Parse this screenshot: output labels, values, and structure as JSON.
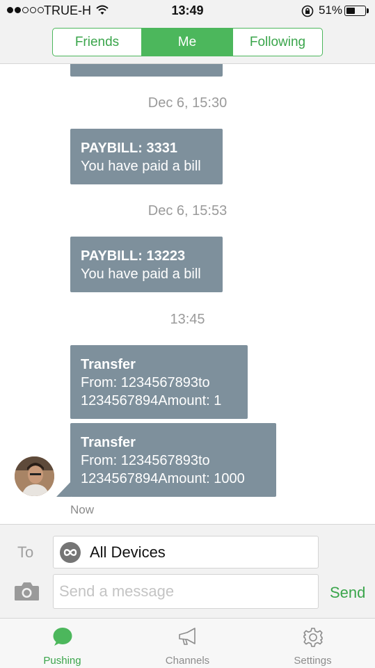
{
  "status_bar": {
    "carrier": "TRUE-H",
    "signal_bars_filled": 2,
    "signal_bars_total": 5,
    "time": "13:49",
    "battery_percent_label": "51%",
    "battery_level": 0.51
  },
  "header": {
    "tabs": [
      {
        "label": "Friends",
        "active": false
      },
      {
        "label": "Me",
        "active": true
      },
      {
        "label": "Following",
        "active": false
      }
    ]
  },
  "chat": {
    "timestamps": [
      "Dec 6, 15:30",
      "Dec 6, 15:53",
      "13:45"
    ],
    "messages": [
      {
        "title": "PAYBILL: 3331",
        "body": "You have paid a bill"
      },
      {
        "title": "PAYBILL: 13223",
        "body": "You have paid a bill"
      },
      {
        "title": "Transfer",
        "body": " From: 1234567893to\n1234567894Amount: 1"
      },
      {
        "title": "Transfer",
        "body": " From: 1234567893to\n1234567894Amount: 1000"
      }
    ],
    "last_status": "Now"
  },
  "compose": {
    "to_label": "To",
    "recipient": "All Devices",
    "message_placeholder": "Send a message",
    "message_value": "",
    "send_label": "Send"
  },
  "tabbar": {
    "items": [
      {
        "label": "Pushing",
        "icon": "speech-bubble-icon",
        "active": true
      },
      {
        "label": "Channels",
        "icon": "megaphone-icon",
        "active": false
      },
      {
        "label": "Settings",
        "icon": "gear-icon",
        "active": false
      }
    ]
  },
  "colors": {
    "accent_green": "#4cb75c",
    "bubble_gray": "#7e909c",
    "timestamp_gray": "#9a9a9a"
  }
}
